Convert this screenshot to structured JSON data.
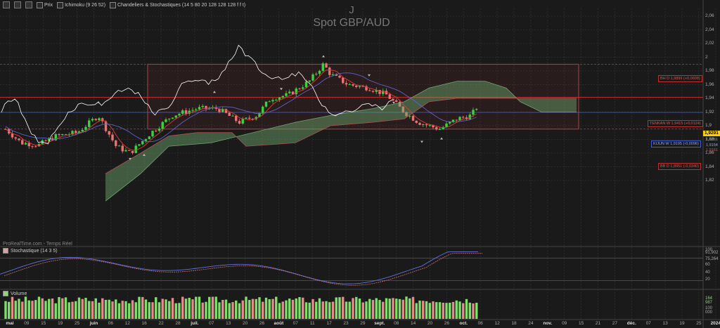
{
  "legend": {
    "items": [
      {
        "name": "price",
        "label": "Prix"
      },
      {
        "name": "ichimoku",
        "label": "Ichimoku (9 26 52)"
      },
      {
        "name": "chandeliers",
        "label": "Chandeliers & Stochastiques (14 5 80 20 128 128 128 f f t)"
      }
    ]
  },
  "chart": {
    "letter": "J",
    "title": "Spot GBP/AUD",
    "source": "ProRealTime.com - Temps Réel"
  },
  "y_axis": {
    "labels": [
      "2,06",
      "2,04",
      "2,02",
      "2",
      "1,98",
      "1,96",
      "1,94",
      "1,92",
      "1,9",
      "1,88",
      "1,86",
      "1,84",
      "1,82"
    ]
  },
  "tags": {
    "bh_d": "BH D 1,9899 (+0,0608)",
    "tenkan": "TENKAN W 1,9415 (+0,0124)",
    "price_current": "1,9291",
    "kijun": "KIJUN W 1,9195 (-0,0096)",
    "small_1": "1,9261",
    "small_2": "1,9154",
    "small_3": "1,9161",
    "bb_d": "BB D 1,8951 (-0,0340)"
  },
  "stoch": {
    "label": "Stochastique (14 3 5)",
    "axis": [
      "100",
      "91,902",
      "75,264",
      "60",
      "40",
      "20"
    ],
    "overbought": 80,
    "oversold": 20
  },
  "volume": {
    "label": "Volume",
    "axis": [
      "164 987",
      "100 000"
    ]
  },
  "x_axis": {
    "labels": [
      {
        "t": "mai",
        "m": true
      },
      {
        "t": "09"
      },
      {
        "t": "15"
      },
      {
        "t": "19"
      },
      {
        "t": "25"
      },
      {
        "t": "juin",
        "m": true
      },
      {
        "t": "06"
      },
      {
        "t": "12"
      },
      {
        "t": "16"
      },
      {
        "t": "22"
      },
      {
        "t": "28"
      },
      {
        "t": "juil.",
        "m": true
      },
      {
        "t": "07"
      },
      {
        "t": "13"
      },
      {
        "t": "20"
      },
      {
        "t": "26"
      },
      {
        "t": "août",
        "m": true
      },
      {
        "t": "07"
      },
      {
        "t": "11"
      },
      {
        "t": "17"
      },
      {
        "t": "23"
      },
      {
        "t": "29"
      },
      {
        "t": "sept.",
        "m": true
      },
      {
        "t": "08"
      },
      {
        "t": "14"
      },
      {
        "t": "20"
      },
      {
        "t": "26"
      },
      {
        "t": "oct.",
        "m": true
      },
      {
        "t": "06"
      },
      {
        "t": "12"
      },
      {
        "t": "18"
      },
      {
        "t": "24"
      },
      {
        "t": "nov.",
        "m": true
      },
      {
        "t": "09"
      },
      {
        "t": "15"
      },
      {
        "t": "21"
      },
      {
        "t": "27"
      },
      {
        "t": "déc.",
        "m": true
      },
      {
        "t": "07"
      },
      {
        "t": "13"
      },
      {
        "t": "19"
      },
      {
        "t": "25"
      },
      {
        "t": "2024",
        "m": true
      }
    ]
  },
  "colors": {
    "bull": "#3cd23c",
    "bear": "#f07070",
    "cloud_bull": "#6fa46f",
    "cloud_bear": "#b05050",
    "tenkan": "#e23a3a",
    "kijun": "#6060c8",
    "chikou": "#ffffff",
    "line_red": "#d03030",
    "line_blue": "#4060d0",
    "box": "#d05050"
  }
}
